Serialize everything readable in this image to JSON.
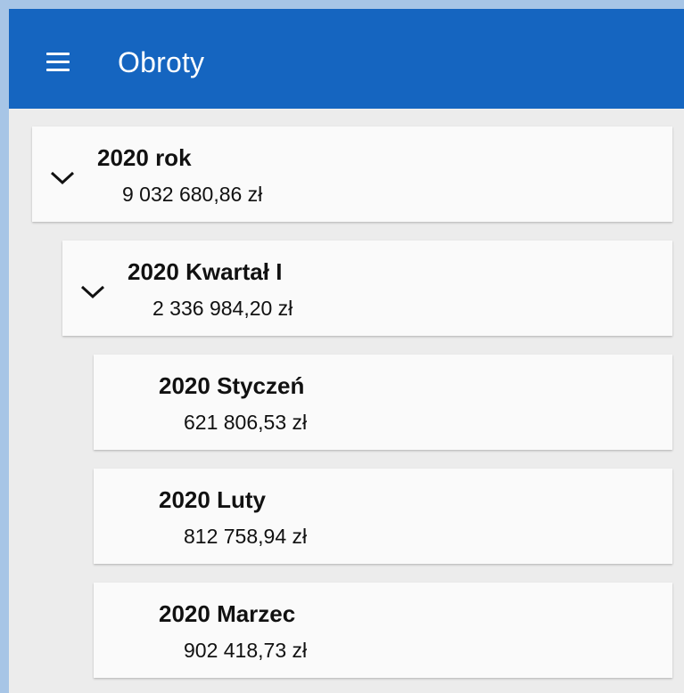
{
  "appbar": {
    "menu_icon": "hamburger-menu-icon",
    "title": "Obroty",
    "color": "#1565c0"
  },
  "tree": {
    "year": {
      "title": "2020 rok",
      "value": "9 032 680,86 zł",
      "expanded": true,
      "icon": "chevron-down-icon"
    },
    "quarter": {
      "title": "2020 Kwartał I",
      "value": "2 336 984,20 zł",
      "expanded": true,
      "icon": "chevron-down-icon"
    },
    "months": [
      {
        "title": "2020 Styczeń",
        "value": "621 806,53 zł"
      },
      {
        "title": "2020 Luty",
        "value": "812 758,94 zł"
      },
      {
        "title": "2020 Marzec",
        "value": "902 418,73 zł"
      }
    ]
  }
}
